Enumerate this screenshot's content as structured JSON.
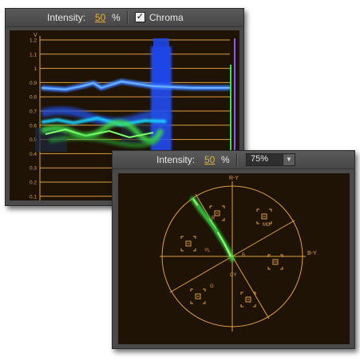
{
  "waveform_panel": {
    "intensity_label": "Intensity:",
    "intensity_value": "50",
    "intensity_unit": "%",
    "chroma_label": "Chroma",
    "chroma_checked": "✓",
    "scale_unit": "V",
    "scale_labels": [
      "1.2",
      "1.1",
      "1",
      "0.9",
      "0.8",
      "0.7",
      "0.6",
      "0.5",
      "0.4",
      "0.3",
      "0.2",
      "0.1"
    ]
  },
  "vectorscope_panel": {
    "intensity_label": "Intensity:",
    "intensity_value": "50",
    "intensity_unit": "%",
    "zoom_value": "75%",
    "zoom_arrow": "▼",
    "axis_labels": {
      "r_y": "R-Y",
      "b_y": "B-Y"
    },
    "target_labels": [
      "R",
      "MG",
      "B",
      "CY",
      "G",
      "YL"
    ]
  },
  "colors": {
    "graticule": "#e0a040",
    "waveform_blue": "#2a64ff",
    "waveform_green": "#3ee04a",
    "screen_bg": "#1e1305"
  }
}
